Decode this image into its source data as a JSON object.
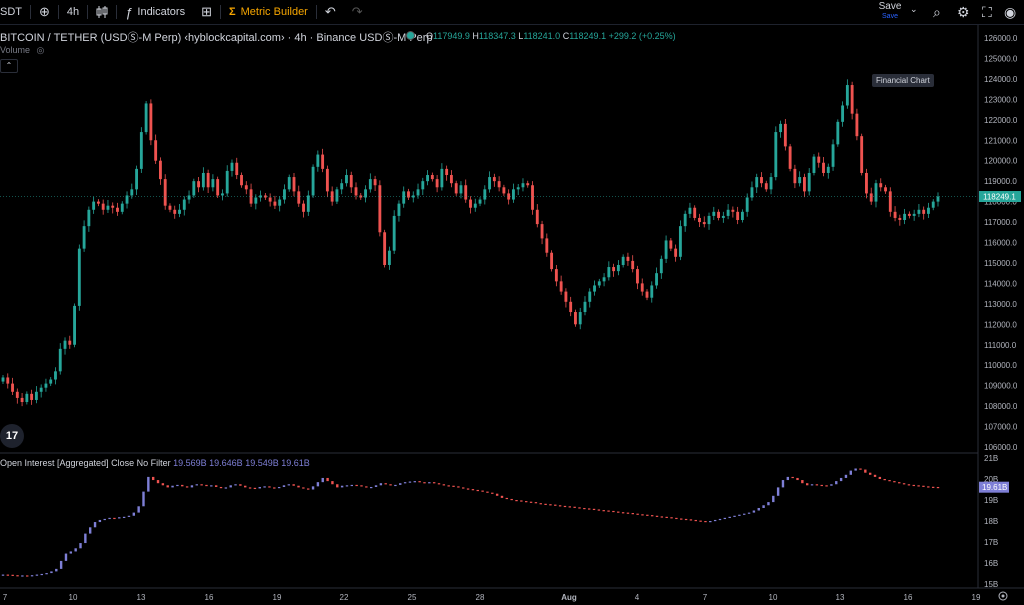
{
  "toolbar": {
    "symbol_fragment": "SDT",
    "interval": "4h",
    "indicators_label": "Indicators",
    "metric_builder_label": "Metric Builder",
    "save_label": "Save",
    "save_sub": "Save"
  },
  "legend": {
    "title": "BITCOIN / TETHER (USDⓈ-M Perp) ‹hyblockcapital.com› · 4h · Binance USDⓈ-M Perp",
    "o_key": "O",
    "o_val": "117949.9",
    "h_key": "H",
    "h_val": "118347.3",
    "l_key": "L",
    "l_val": "118241.0",
    "c_key": "C",
    "c_val": "118249.1",
    "change": "+299.2 (+0.25%)",
    "volume_label": "Volume"
  },
  "tooltip": "Financial Chart",
  "oi": {
    "label": "Open Interest [Aggregated] Close No Filter",
    "v1": "19.569B",
    "v2": "19.646B",
    "v3": "19.549B",
    "v4": "19.61B",
    "last_tag": "19.61B"
  },
  "colors": {
    "up": "#26a69a",
    "down": "#ef5350",
    "oi": "#7e7fd6",
    "bg": "#000000",
    "accent": "#f7a600"
  },
  "chart_data": {
    "type": "candlestick",
    "price_axis": [
      "126000.0",
      "125000.0",
      "124000.0",
      "123000.0",
      "122000.0",
      "121000.0",
      "120000.0",
      "119000.0",
      "118000.0",
      "117000.0",
      "116000.0",
      "115000.0",
      "114000.0",
      "113000.0",
      "112000.0",
      "111000.0",
      "110000.0",
      "109000.0",
      "108000.0",
      "107000.0",
      "106000.0"
    ],
    "price_range": [
      106000,
      126000
    ],
    "last_price_tag": "118249.1",
    "last_price": 118249.1,
    "oi_axis": [
      "21B",
      "20B",
      "19B",
      "18B",
      "17B",
      "16B",
      "15B"
    ],
    "oi_range": [
      15,
      21
    ],
    "time_axis": [
      "7",
      "10",
      "13",
      "16",
      "19",
      "22",
      "25",
      "28",
      "Aug",
      "4",
      "7",
      "10",
      "13",
      "16",
      "19"
    ],
    "closes": [
      109400,
      109100,
      108700,
      108400,
      108200,
      108600,
      108300,
      108700,
      108900,
      109100,
      109300,
      109700,
      110800,
      111200,
      111000,
      112900,
      115700,
      116800,
      117600,
      118000,
      117900,
      117600,
      117800,
      117700,
      117500,
      117900,
      118300,
      118600,
      119600,
      121400,
      122800,
      121000,
      120000,
      119100,
      117800,
      117600,
      117400,
      117600,
      118100,
      118300,
      119000,
      118700,
      119400,
      118700,
      119100,
      118300,
      118400,
      119500,
      119900,
      119300,
      118800,
      118600,
      117900,
      118200,
      118300,
      118200,
      118000,
      117800,
      118100,
      118600,
      119200,
      118500,
      117900,
      117500,
      118300,
      119700,
      120300,
      119600,
      118500,
      118000,
      118600,
      118900,
      119300,
      118700,
      118300,
      118200,
      118600,
      119100,
      118800,
      116500,
      114900,
      115600,
      117300,
      117900,
      118500,
      118200,
      118300,
      118600,
      119000,
      119300,
      119100,
      118700,
      119600,
      119300,
      118900,
      118400,
      118800,
      118100,
      117700,
      117900,
      118100,
      118600,
      119200,
      119000,
      118700,
      118400,
      118100,
      118600,
      118700,
      118900,
      118800,
      117600,
      116900,
      116200,
      115500,
      114700,
      114100,
      113600,
      113100,
      112600,
      112000,
      112600,
      113100,
      113600,
      113900,
      114100,
      114300,
      114800,
      114600,
      114900,
      115300,
      115100,
      114700,
      114000,
      113600,
      113300,
      113900,
      114500,
      115200,
      116100,
      115700,
      115300,
      116800,
      117400,
      117700,
      117200,
      117000,
      116900,
      117300,
      117500,
      117200,
      117300,
      117600,
      117500,
      117100,
      117500,
      118200,
      118700,
      119200,
      118900,
      118600,
      119200,
      121400,
      121800,
      120700,
      119600,
      118900,
      119200,
      118500,
      119400,
      120200,
      119900,
      119400,
      119700,
      120800,
      121900,
      122700,
      123700,
      122300,
      121200,
      119400,
      118400,
      118000,
      118900,
      118700,
      118500,
      117500,
      117200,
      117100,
      117400,
      117300,
      117400,
      117600,
      117400,
      117700,
      118000,
      118249.1
    ],
    "oi_series": [
      15.45,
      15.44,
      15.42,
      15.4,
      15.41,
      15.4,
      15.42,
      15.45,
      15.48,
      15.52,
      15.6,
      15.72,
      16.1,
      16.45,
      16.55,
      16.7,
      16.95,
      17.4,
      17.7,
      17.95,
      18.05,
      18.1,
      18.15,
      18.12,
      18.18,
      18.2,
      18.25,
      18.4,
      18.7,
      19.4,
      20.1,
      19.95,
      19.8,
      19.7,
      19.6,
      19.68,
      19.72,
      19.65,
      19.6,
      19.7,
      19.75,
      19.72,
      19.66,
      19.7,
      19.62,
      19.58,
      19.6,
      19.7,
      19.75,
      19.68,
      19.6,
      19.58,
      19.55,
      19.62,
      19.65,
      19.6,
      19.58,
      19.62,
      19.7,
      19.75,
      19.68,
      19.6,
      19.55,
      19.5,
      19.65,
      19.85,
      20.05,
      19.9,
      19.75,
      19.6,
      19.68,
      19.7,
      19.72,
      19.7,
      19.65,
      19.6,
      19.62,
      19.7,
      19.8,
      19.75,
      19.7,
      19.72,
      19.8,
      19.85,
      19.88,
      19.9,
      19.85,
      19.82,
      19.85,
      19.8,
      19.75,
      19.7,
      19.68,
      19.65,
      19.6,
      19.55,
      19.52,
      19.48,
      19.45,
      19.4,
      19.35,
      19.3,
      19.2,
      19.1,
      19.05,
      19.0,
      18.98,
      18.95,
      18.92,
      18.9,
      18.85,
      18.82,
      18.8,
      18.78,
      18.75,
      18.72,
      18.7,
      18.68,
      18.65,
      18.62,
      18.6,
      18.58,
      18.55,
      18.52,
      18.5,
      18.48,
      18.45,
      18.42,
      18.4,
      18.38,
      18.35,
      18.32,
      18.3,
      18.28,
      18.25,
      18.22,
      18.2,
      18.18,
      18.15,
      18.12,
      18.1,
      18.08,
      18.05,
      18.02,
      18.0,
      17.98,
      18.0,
      18.05,
      18.1,
      18.15,
      18.2,
      18.25,
      18.3,
      18.35,
      18.4,
      18.5,
      18.62,
      18.75,
      18.9,
      19.2,
      19.6,
      19.95,
      20.1,
      20.05,
      19.95,
      19.8,
      19.7,
      19.75,
      19.72,
      19.7,
      19.68,
      19.75,
      19.9,
      20.05,
      20.2,
      20.4,
      20.5,
      20.45,
      20.3,
      20.2,
      20.1,
      20.0,
      19.95,
      19.9,
      19.85,
      19.8,
      19.75,
      19.72,
      19.7,
      19.68,
      19.65,
      19.63,
      19.62,
      19.61
    ]
  }
}
